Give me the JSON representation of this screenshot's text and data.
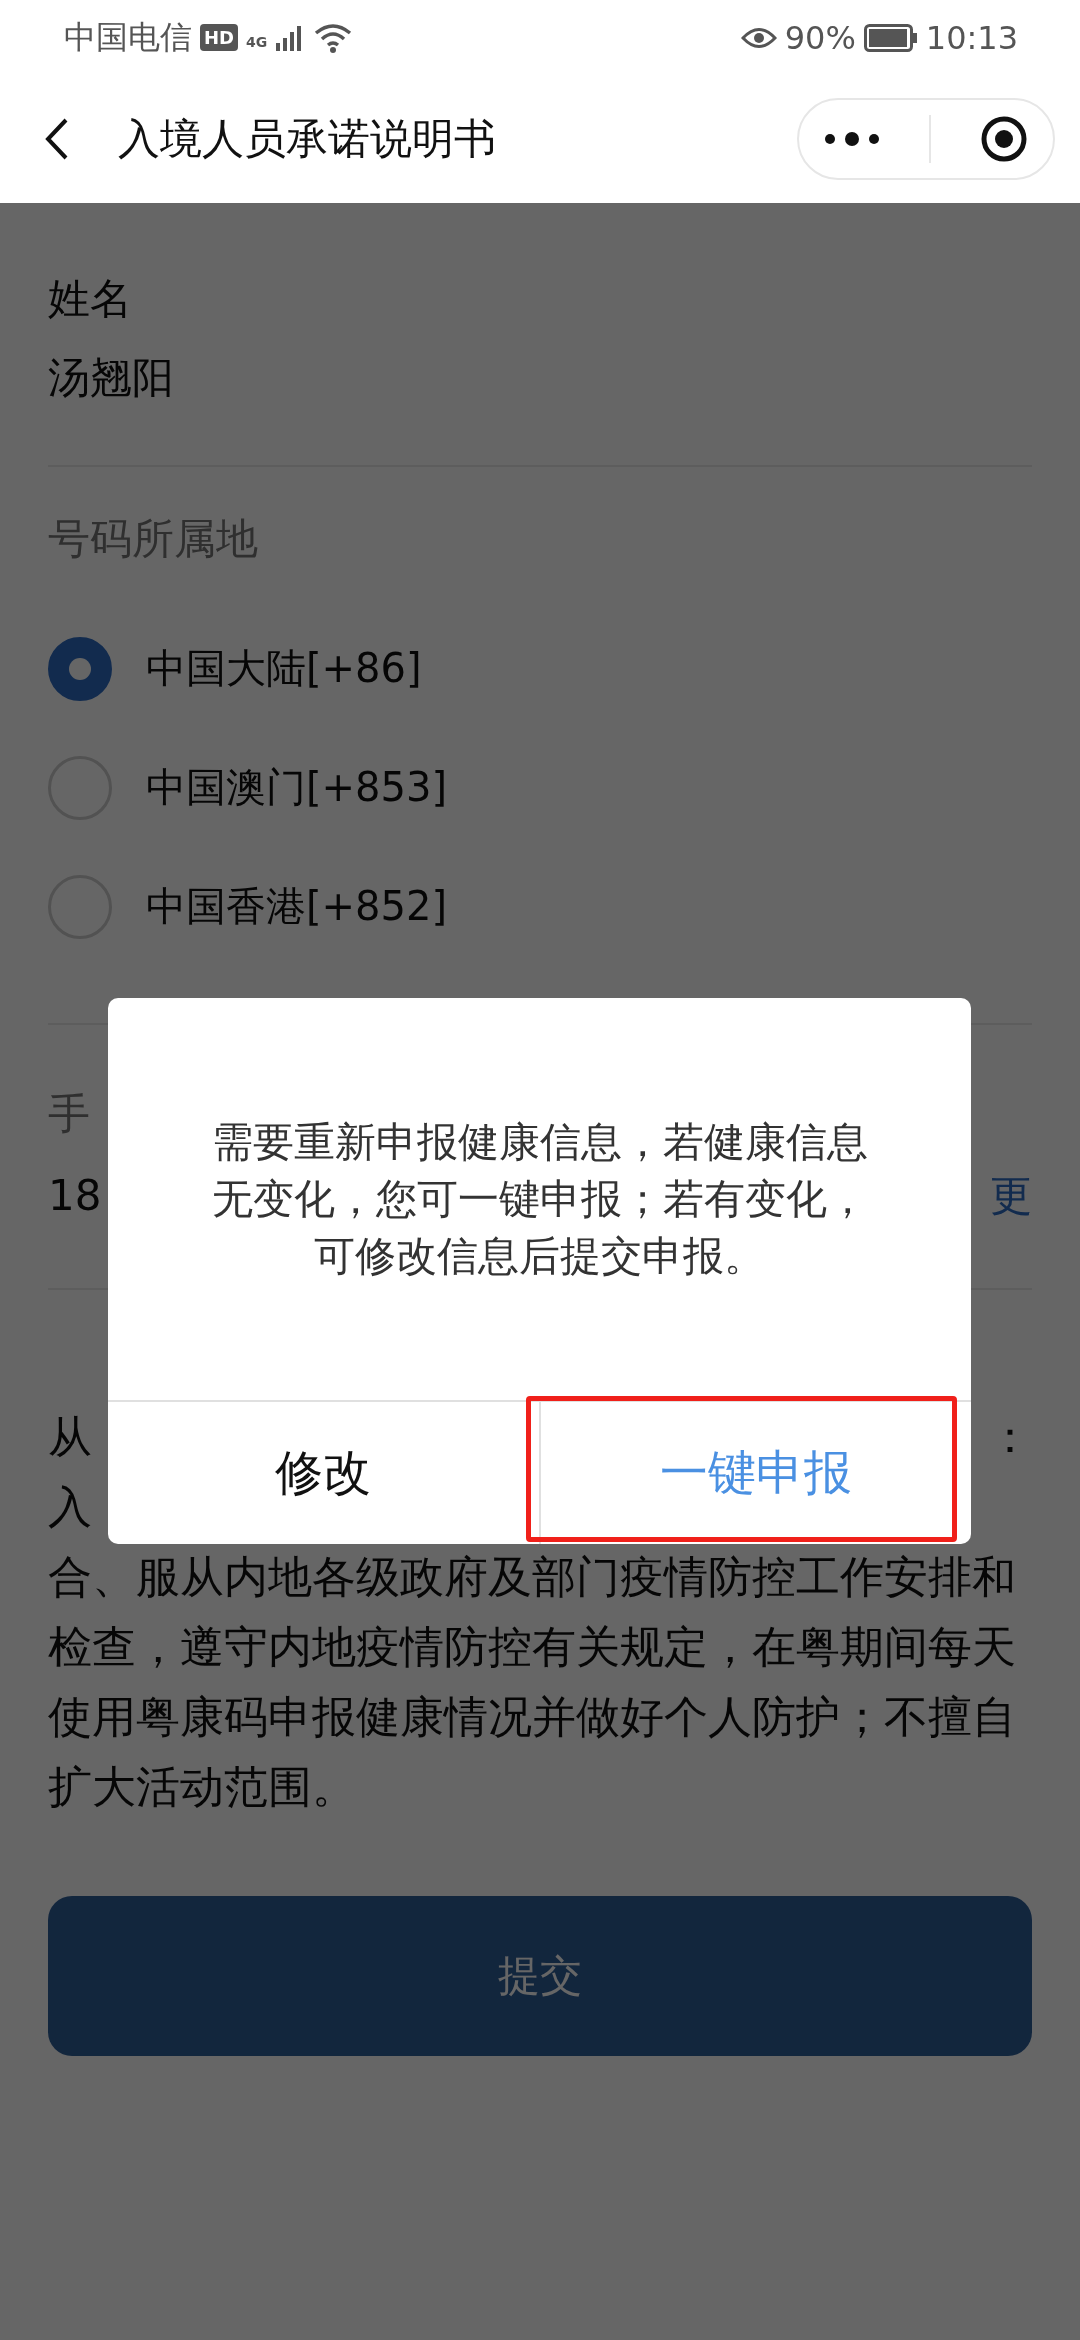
{
  "status_bar": {
    "carrier": "中国电信",
    "hd_badge": "HD",
    "network": "4G",
    "battery": "90%",
    "time": "10:13"
  },
  "nav": {
    "title": "入境人员承诺说明书"
  },
  "name_field": {
    "label": "姓名",
    "value": "汤翘阳"
  },
  "phone_region": {
    "label": "号码所属地",
    "options": [
      {
        "label": "中国大陆[+86]",
        "selected": true
      },
      {
        "label": "中国澳门[+853]",
        "selected": false
      },
      {
        "label": "中国香港[+852]",
        "selected": false
      }
    ]
  },
  "phone": {
    "label": "手",
    "value": "18",
    "action": "更"
  },
  "statement": {
    "lines": [
      {
        "left": "从",
        "right": "："
      },
      {
        "left": "入"
      },
      {
        "text": "合、服从内地各级政府及部门疫情防控工作安排和"
      },
      {
        "text": "检查，遵守内地疫情防控有关规定，在粤期间每天"
      },
      {
        "text": "使用粤康码申报健康情况并做好个人防护；不擅自"
      },
      {
        "text": "扩大活动范围。"
      }
    ]
  },
  "submit": {
    "label": "提交"
  },
  "dialog": {
    "message": "需要重新申报健康信息，若健康信息无变化，您可一键申报；若有变化，可修改信息后提交申报。",
    "buttons": [
      {
        "label": "修改",
        "primary": false,
        "highlighted": false
      },
      {
        "label": "一键申报",
        "primary": true,
        "highlighted": true
      }
    ]
  }
}
